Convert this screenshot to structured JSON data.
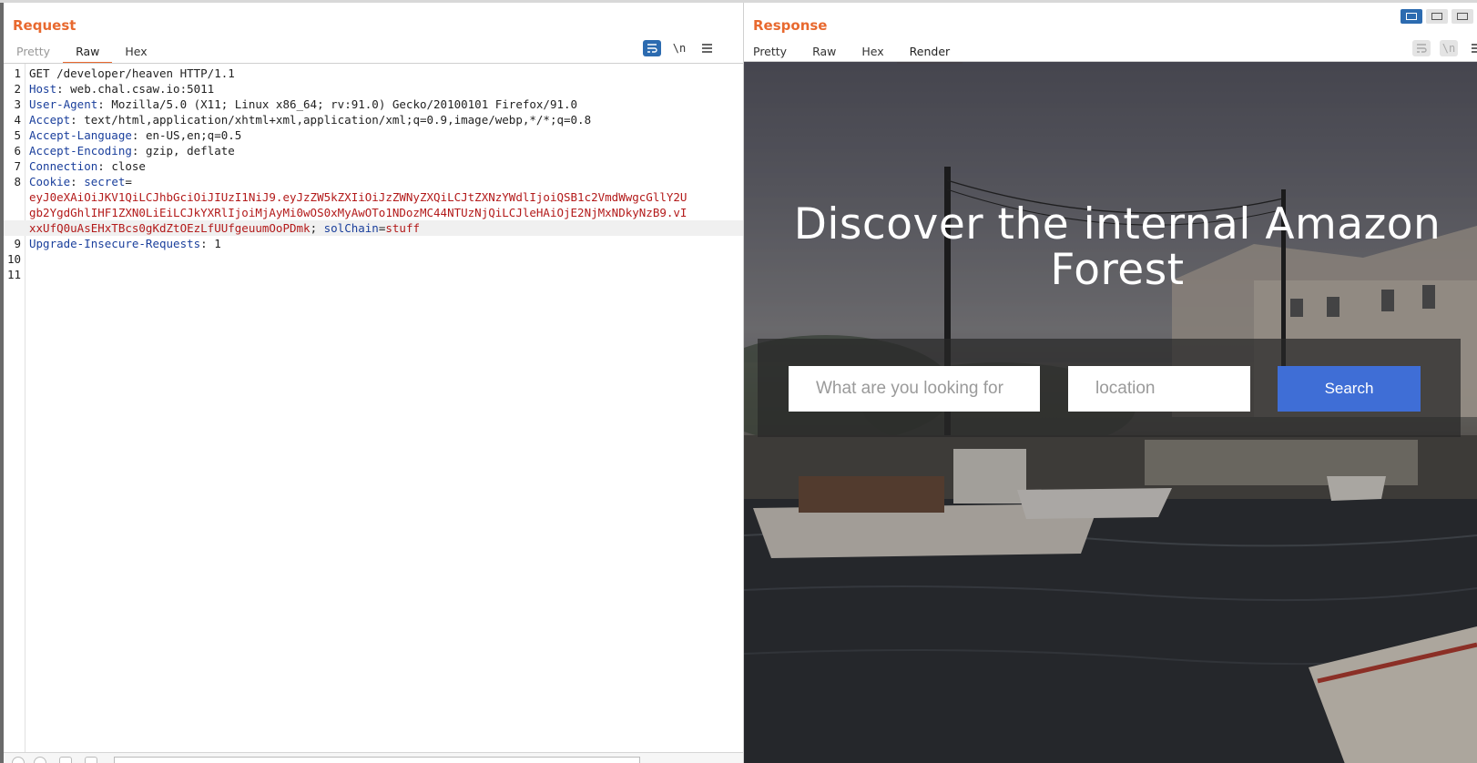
{
  "request": {
    "title": "Request",
    "tabs": [
      "Pretty",
      "Raw",
      "Hex"
    ],
    "active_tab": "Raw",
    "toolbar": {
      "wrap_icon": "wrap-lines-icon",
      "newline_label": "\\n",
      "menu_icon": "hamburger-icon"
    },
    "lines": [
      {
        "num": "1",
        "parts": [
          {
            "t": "GET /developer/heaven HTTP/1.1",
            "c": "v"
          }
        ]
      },
      {
        "num": "2",
        "parts": [
          {
            "t": "Host",
            "c": "k"
          },
          {
            "t": ": web.chal.csaw.io:5011",
            "c": "v"
          }
        ]
      },
      {
        "num": "3",
        "parts": [
          {
            "t": "User-Agent",
            "c": "k"
          },
          {
            "t": ": Mozilla/5.0 (X11; Linux x86_64; rv:91.0) Gecko/20100101 Firefox/91.0",
            "c": "v"
          }
        ]
      },
      {
        "num": "4",
        "parts": [
          {
            "t": "Accept",
            "c": "k"
          },
          {
            "t": ": text/html,application/xhtml+xml,application/xml;q=0.9,image/webp,*/*;q=0.8",
            "c": "v"
          }
        ]
      },
      {
        "num": "5",
        "parts": [
          {
            "t": "Accept-Language",
            "c": "k"
          },
          {
            "t": ": en-US,en;q=0.5",
            "c": "v"
          }
        ]
      },
      {
        "num": "6",
        "parts": [
          {
            "t": "Accept-Encoding",
            "c": "k"
          },
          {
            "t": ": gzip, deflate",
            "c": "v"
          }
        ]
      },
      {
        "num": "7",
        "parts": [
          {
            "t": "Connection",
            "c": "k"
          },
          {
            "t": ": close",
            "c": "v"
          }
        ]
      },
      {
        "num": "8",
        "parts": [
          {
            "t": "Cookie",
            "c": "k"
          },
          {
            "t": ": ",
            "c": "v"
          },
          {
            "t": "secret",
            "c": "k"
          },
          {
            "t": "=",
            "c": "v"
          }
        ]
      },
      {
        "num": "",
        "parts": [
          {
            "t": "eyJ0eXAiOiJKV1QiLCJhbGciOiJIUzI1NiJ9.eyJzZW5kZXIiOiJzZWNyZXQiLCJtZXNzYWdlIjoiQSB1c2VmdWwgcGllY2U",
            "c": "red"
          }
        ]
      },
      {
        "num": "",
        "parts": [
          {
            "t": "gb2YgdGhlIHF1ZXN0LiEiLCJkYXRlIjoiMjAyMi0wOS0xMyAwOTo1NDozMC44NTUzNjQiLCJleHAiOjE2NjMxNDkyNzB9.vI",
            "c": "red"
          }
        ]
      },
      {
        "num": "",
        "hl": true,
        "parts": [
          {
            "t": "xxUfQ0uAsEHxTBcs0gKdZtOEzLfUUfgeuumOoPDmk",
            "c": "red"
          },
          {
            "t": "; ",
            "c": "v"
          },
          {
            "t": "solChain",
            "c": "k"
          },
          {
            "t": "=",
            "c": "v"
          },
          {
            "t": "stuff",
            "c": "red"
          }
        ]
      },
      {
        "num": "9",
        "parts": [
          {
            "t": "Upgrade-Insecure-Requests",
            "c": "k"
          },
          {
            "t": ": 1",
            "c": "v"
          }
        ]
      },
      {
        "num": "10",
        "parts": []
      },
      {
        "num": "11",
        "parts": []
      }
    ]
  },
  "response": {
    "title": "Response",
    "tabs": [
      "Pretty",
      "Raw",
      "Hex",
      "Render"
    ],
    "active_tab": "Render",
    "render": {
      "headline": "Discover the internal Amazon Forest",
      "search_placeholder": "What are you looking for",
      "location_placeholder": "location",
      "search_button": "Search"
    }
  },
  "colors": {
    "accent": "#e8692f",
    "header_key": "#1a3f9c",
    "cookie_value": "#b31a1a",
    "search_button": "#3f6ed6",
    "toggle_on": "#2c6bb0"
  }
}
